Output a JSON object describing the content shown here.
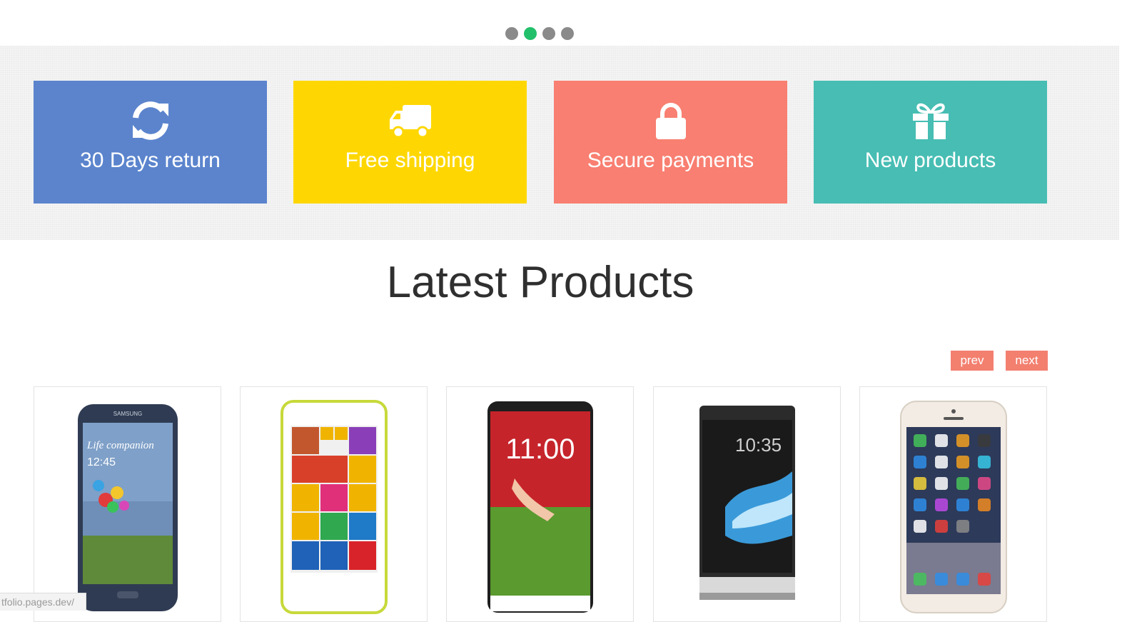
{
  "slider": {
    "dot_count": 4,
    "active_index": 1
  },
  "features": [
    {
      "label": "30 Days return",
      "icon": "refresh-icon",
      "color": "#5b84cd"
    },
    {
      "label": "Free shipping",
      "icon": "truck-icon",
      "color": "#fed703"
    },
    {
      "label": "Secure payments",
      "icon": "lock-icon",
      "color": "#f87f71"
    },
    {
      "label": "New products",
      "icon": "gift-icon",
      "color": "#47bdb3"
    }
  ],
  "latest": {
    "title": "Latest Products",
    "prev_label": "prev",
    "next_label": "next",
    "accent": "#f37f6f"
  },
  "products": [
    {
      "name": "samsung-galaxy",
      "brand_text": "SAMSUNG",
      "screen_text": "Life companion",
      "screen_time": "12:45"
    },
    {
      "name": "windows-phone"
    },
    {
      "name": "lg-g2",
      "screen_time": "11:00"
    },
    {
      "name": "sony-xperia",
      "screen_time": "10:35"
    },
    {
      "name": "iphone-6"
    }
  ],
  "status_bar": {
    "url_text": "tfolio.pages.dev/"
  }
}
